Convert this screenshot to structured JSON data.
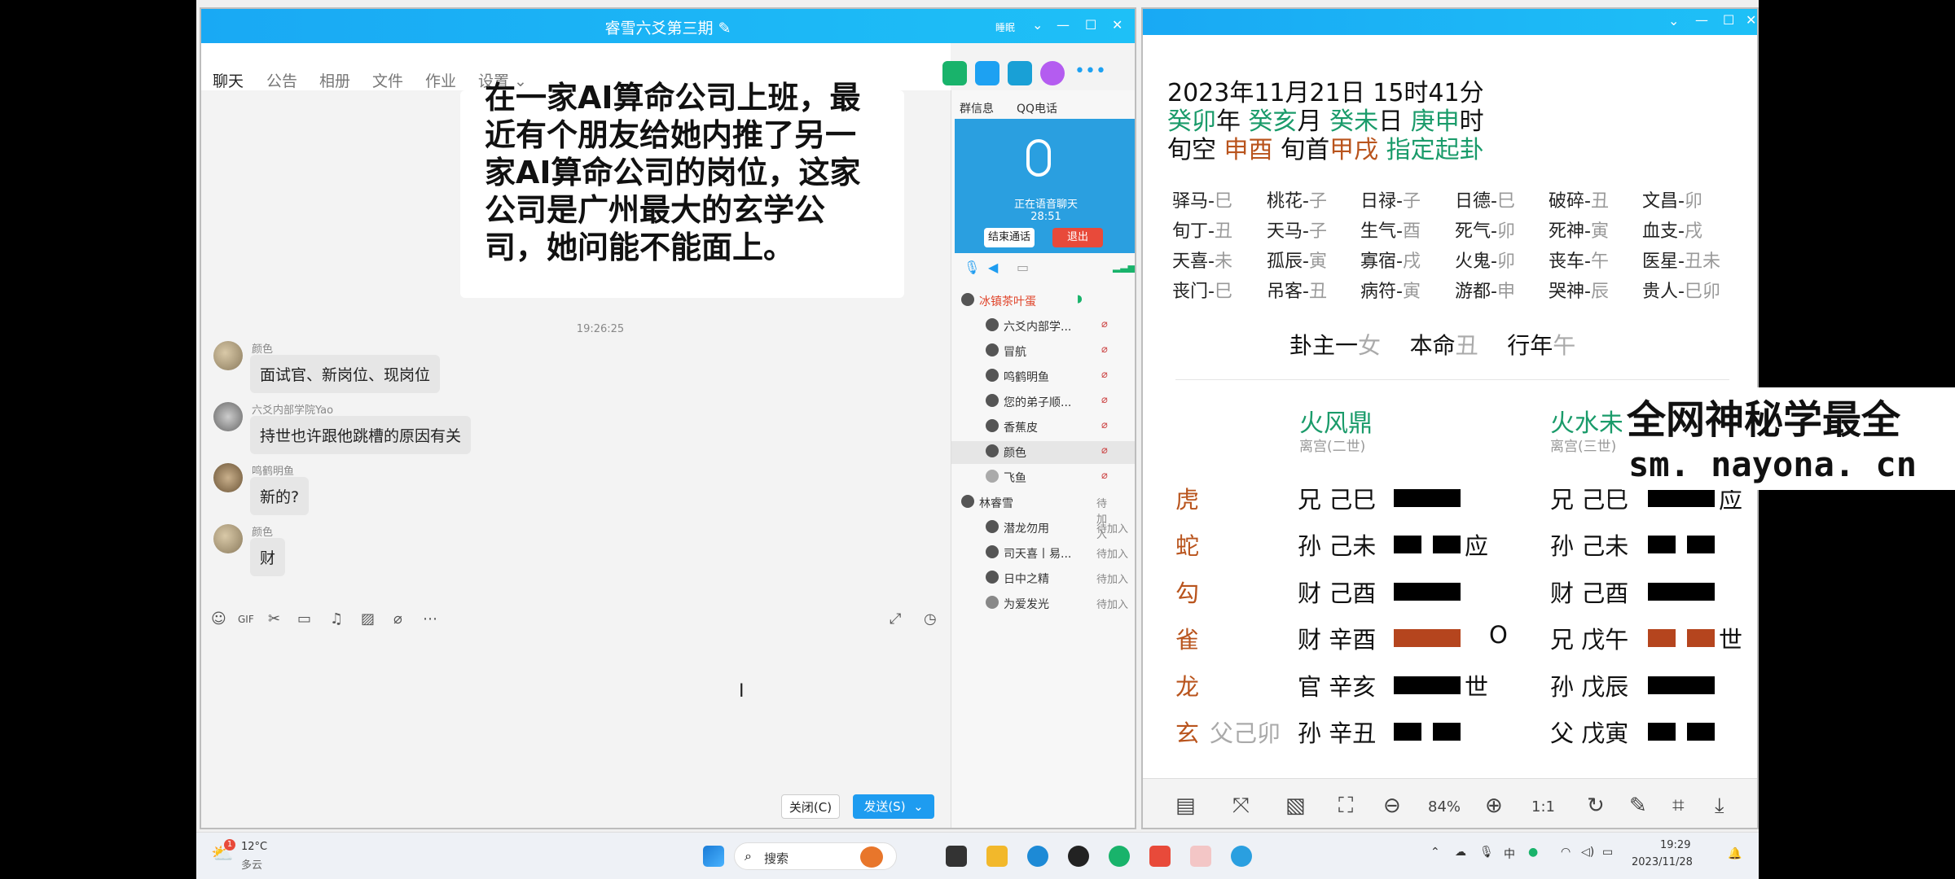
{
  "qq": {
    "title": "睿雪六爻第三期",
    "title_edit_icon": "edit-icon",
    "title_right": "睡眠",
    "tabs": [
      "聊天",
      "公告",
      "相册",
      "文件",
      "作业",
      "设置"
    ],
    "big_message": "在一家AI算命公司上班，最近有个朋友给她内推了另一家AI算命公司的岗位，这家公司是广州最大的玄学公司，她问能不能面上。",
    "timestamp": "19:26:25",
    "messages": [
      {
        "nick": "颜色",
        "text": "面试官、新岗位、现岗位"
      },
      {
        "nick": "六爻内部学院Yao",
        "text": "持世也许跟他跳槽的原因有关"
      },
      {
        "nick": "鸣鹤明鱼",
        "text": "新的?"
      },
      {
        "nick": "颜色",
        "text": "财"
      }
    ],
    "close_btn": "关闭(C)",
    "send_btn": "发送(S)",
    "right_tabs": [
      "群信息",
      "QQ电话"
    ],
    "voice_status": "正在语音聊天",
    "voice_time": "28:51",
    "end_call": "结束通话",
    "exit": "退出",
    "members": [
      {
        "name": "冰镇茶叶蛋",
        "status": ""
      },
      {
        "name": "六爻内部学...",
        "status": ""
      },
      {
        "name": "冒航",
        "status": ""
      },
      {
        "name": "鸣鹤明鱼",
        "status": ""
      },
      {
        "name": "您的弟子顺...",
        "status": ""
      },
      {
        "name": "香蕉皮",
        "status": ""
      },
      {
        "name": "颜色",
        "status": ""
      },
      {
        "name": "飞鱼",
        "status": ""
      },
      {
        "name": "林睿雪",
        "status": "待加入"
      },
      {
        "name": "潜龙勿用",
        "status": "待加入"
      },
      {
        "name": "司天喜丨易...",
        "status": "待加入"
      },
      {
        "name": "日中之精",
        "status": "待加入"
      },
      {
        "name": "为爱发光",
        "status": "待加入"
      }
    ]
  },
  "liuyao": {
    "date_line": "2023年11月21日 15时41分",
    "ganzhi": [
      {
        "gz": "癸卯",
        "unit": "年"
      },
      {
        "gz": "癸亥",
        "unit": "月"
      },
      {
        "gz": "癸未",
        "unit": "日"
      },
      {
        "gz": "庚申",
        "unit": "时"
      }
    ],
    "xunkong_label": "旬空",
    "xunkong": "申酉",
    "xunshou_label": "旬首",
    "xunshou": "甲戌",
    "zhiding": "指定起卦",
    "shensha": [
      [
        "驿马-",
        "巳",
        "桃花-",
        "子",
        "日禄-",
        "子",
        "日德-",
        "巳",
        "破碎-",
        "丑",
        "文昌-",
        "卯"
      ],
      [
        "旬丁-",
        "丑",
        "天马-",
        "子",
        "生气-",
        "酉",
        "死气-",
        "卯",
        "死神-",
        "寅",
        "血支-",
        "戌"
      ],
      [
        "天喜-",
        "未",
        "孤辰-",
        "寅",
        "寡宿-",
        "戌",
        "火鬼-",
        "卯",
        "丧车-",
        "午",
        "医星-",
        "丑未"
      ],
      [
        "丧门-",
        "巳",
        "吊客-",
        "丑",
        "病符-",
        "寅",
        "游都-",
        "申",
        "哭神-",
        "辰",
        "贵人-",
        "巳卯"
      ]
    ],
    "guazhu": "卦主一",
    "guazhu_v": "女",
    "benming": "本命",
    "benming_v": "丑",
    "xingnian": "行年",
    "xingnian_v": "午",
    "gua1_name": "火风鼎",
    "gua1_palace": "离宫(二世)",
    "gua2_name": "火水未",
    "gua2_palace": "离宫(三世)",
    "gods": [
      "虎",
      "蛇",
      "勾",
      "雀",
      "龙",
      "玄"
    ],
    "fushen": "父己卯",
    "left_lines": [
      "兄 己巳",
      "孙 己未",
      "财 己酉",
      "财 辛酉",
      "官 辛亥",
      "孙 辛丑"
    ],
    "left_marks": [
      "",
      "应",
      "",
      "O",
      "世",
      ""
    ],
    "right_lines": [
      "兄 己巳",
      "孙 己未",
      "财 己酉",
      "兄 戊午",
      "孙 戊辰",
      "父 戊寅"
    ],
    "right_marks": [
      "应",
      "",
      "",
      "世",
      "",
      ""
    ],
    "zoom": "84%"
  },
  "watermark": {
    "line1": "全网神秘学最全",
    "line2": "sm. nayona. cn"
  },
  "taskbar": {
    "temp": "12°C",
    "weather": "多云",
    "weather_badge": "1",
    "search": "搜索",
    "time": "19:29",
    "date": "2023/11/28"
  }
}
